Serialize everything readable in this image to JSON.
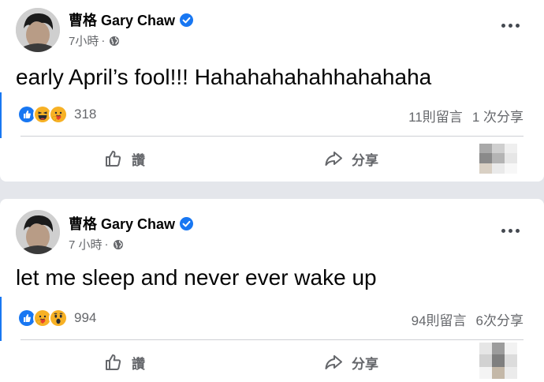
{
  "posts": [
    {
      "author": "曹格 Gary Chaw",
      "time": "7小時",
      "separator": "·",
      "text": "early April’s fool!!! Hahahahahahhahahaha",
      "reactions": [
        "like-icon",
        "laugh-icon",
        "care-icon"
      ],
      "reaction_count": "318",
      "comments": "11則留言",
      "shares": "1 次分享",
      "like_label": "讚",
      "share_label": "分享"
    },
    {
      "author": "曹格 Gary Chaw",
      "time": "7 小時",
      "separator": "·",
      "text": "let me sleep and never ever wake up",
      "reactions": [
        "like-icon",
        "care-icon",
        "wow-icon"
      ],
      "reaction_count": "994",
      "comments": "94則留言",
      "shares": "6次分享",
      "like_label": "讚",
      "share_label": "分享"
    }
  ],
  "colors": {
    "background": "#e4e6eb",
    "card": "#ffffff",
    "accent": "#1877f2",
    "secondary_text": "#65676b",
    "reaction_yellow": "#f7b125",
    "reaction_red": "#e9412d"
  }
}
